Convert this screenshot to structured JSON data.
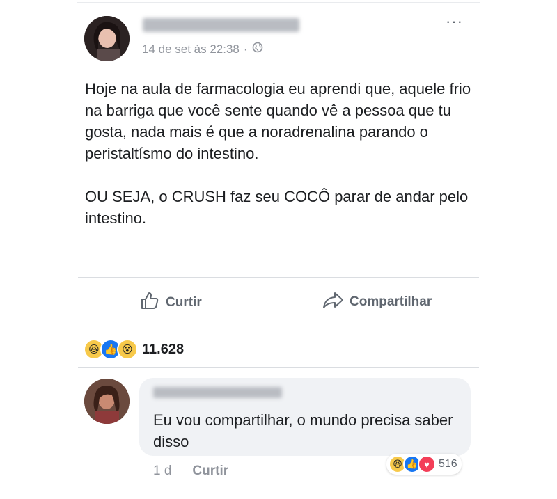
{
  "post": {
    "timestamp": "14 de set às 22:38",
    "separator": "·",
    "privacy_icon": "globe-icon",
    "paragraphs": [
      "Hoje na aula de farmacologia eu aprendi que, aquele frio na barriga que você sente quando vê a pessoa que tu gosta, nada mais é que a noradrenalina parando o peristaltísmo do intestino.",
      "OU SEJA, o CRUSH faz seu COCÔ parar de andar pelo intestino."
    ],
    "actions": {
      "like_label": "Curtir",
      "share_label": "Compartilhar"
    },
    "reactions": {
      "types": [
        "haha",
        "like",
        "wow"
      ],
      "count": "11.628"
    }
  },
  "comment": {
    "text": "Eu vou compartilhar, o mundo precisa saber disso",
    "time": "1 d",
    "like_label": "Curtir",
    "reactions": {
      "types": [
        "haha",
        "like",
        "love"
      ],
      "count": "516"
    }
  },
  "colors": {
    "like_blue": "#1877f2",
    "haha_yellow": "#f7c94a",
    "love_red": "#f33e58",
    "secondary_text": "#90949c"
  }
}
